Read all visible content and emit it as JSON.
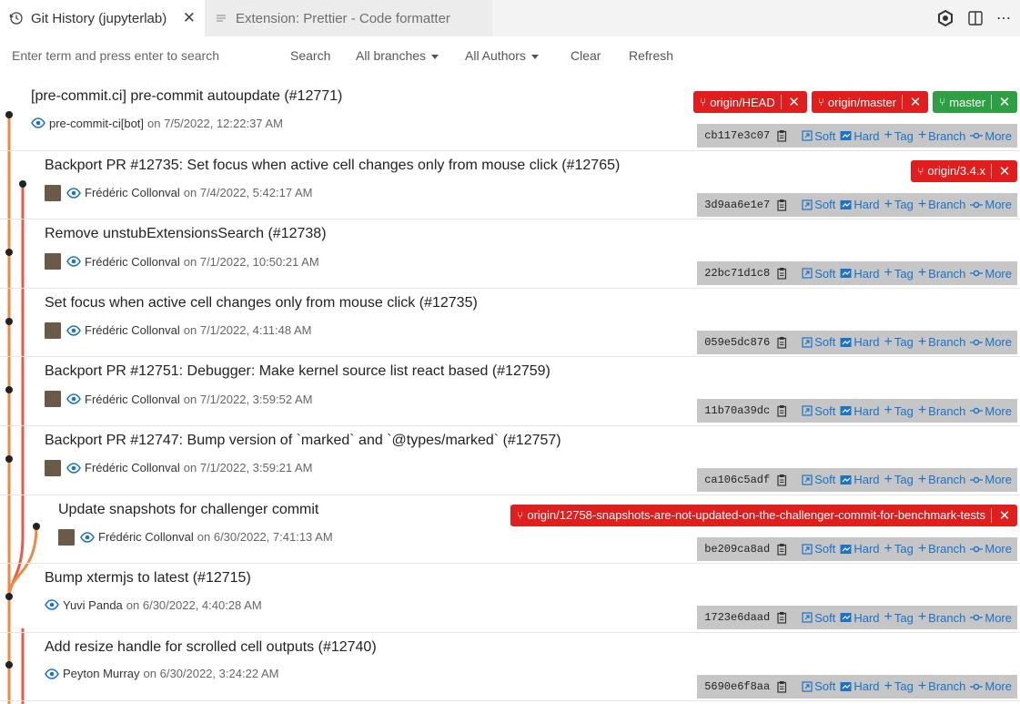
{
  "tabs": [
    {
      "label": "Git History (jupyterlab)",
      "icon": "history-icon",
      "active": true
    },
    {
      "label": "Extension: Prettier - Code formatter",
      "icon": "file-lines-icon",
      "active": false
    }
  ],
  "toolbar": {
    "search_placeholder": "Enter term and press enter to search",
    "search_btn": "Search",
    "branches": "All branches",
    "authors": "All Authors",
    "clear": "Clear",
    "refresh": "Refresh"
  },
  "labels": {
    "soft": "Soft",
    "hard": "Hard",
    "tag": "Tag",
    "branch": "Branch",
    "more": "More",
    "on": "on"
  },
  "colors": {
    "ref_red": "#e01e1e",
    "ref_green": "#2ea043",
    "link": "#1a73c7",
    "graph_orange": "#f0883e",
    "graph_red": "#e8594a"
  },
  "commits": [
    {
      "message": "[pre-commit.ci] pre-commit autoupdate (#12771)",
      "author": "pre-commit-ci[bot]",
      "date": "7/5/2022, 12:22:37 AM",
      "hash": "cb117e3c07",
      "avatar": false,
      "refs": [
        {
          "name": "origin/HEAD",
          "color": "red"
        },
        {
          "name": "origin/master",
          "color": "red"
        },
        {
          "name": "master",
          "color": "green"
        }
      ]
    },
    {
      "message": "Backport PR #12735: Set focus when active cell changes only from mouse click (#12765)",
      "author": "Frédéric Collonval",
      "date": "7/4/2022, 5:42:17 AM",
      "hash": "3d9aa6e1e7",
      "avatar": true,
      "refs": [
        {
          "name": "origin/3.4.x",
          "color": "red"
        }
      ]
    },
    {
      "message": "Remove unstubExtensionsSearch (#12738)",
      "author": "Frédéric Collonval",
      "date": "7/1/2022, 10:50:21 AM",
      "hash": "22bc71d1c8",
      "avatar": true,
      "refs": []
    },
    {
      "message": "Set focus when active cell changes only from mouse click (#12735)",
      "author": "Frédéric Collonval",
      "date": "7/1/2022, 4:11:48 AM",
      "hash": "059e5dc876",
      "avatar": true,
      "refs": []
    },
    {
      "message": "Backport PR #12751: Debugger: Make kernel source list react based (#12759)",
      "author": "Frédéric Collonval",
      "date": "7/1/2022, 3:59:52 AM",
      "hash": "11b70a39dc",
      "avatar": true,
      "refs": []
    },
    {
      "message": "Backport PR #12747: Bump version of `marked` and `@types/marked` (#12757)",
      "author": "Frédéric Collonval",
      "date": "7/1/2022, 3:59:21 AM",
      "hash": "ca106c5adf",
      "avatar": true,
      "refs": []
    },
    {
      "message": "Update snapshots for challenger commit",
      "author": "Frédéric Collonval",
      "date": "6/30/2022, 7:41:13 AM",
      "hash": "be209ca8ad",
      "avatar": true,
      "refs": [
        {
          "name": "origin/12758-snapshots-are-not-updated-on-the-challenger-commit-for-benchmark-tests",
          "color": "red"
        }
      ]
    },
    {
      "message": "Bump xtermjs to latest (#12715)",
      "author": "Yuvi Panda",
      "date": "6/30/2022, 4:40:28 AM",
      "hash": "1723e6daad",
      "avatar": false,
      "refs": []
    },
    {
      "message": "Add resize handle for scrolled cell outputs (#12740)",
      "author": "Peyton Murray",
      "date": "6/30/2022, 3:24:22 AM",
      "hash": "5690e6f8aa",
      "avatar": false,
      "refs": []
    }
  ]
}
